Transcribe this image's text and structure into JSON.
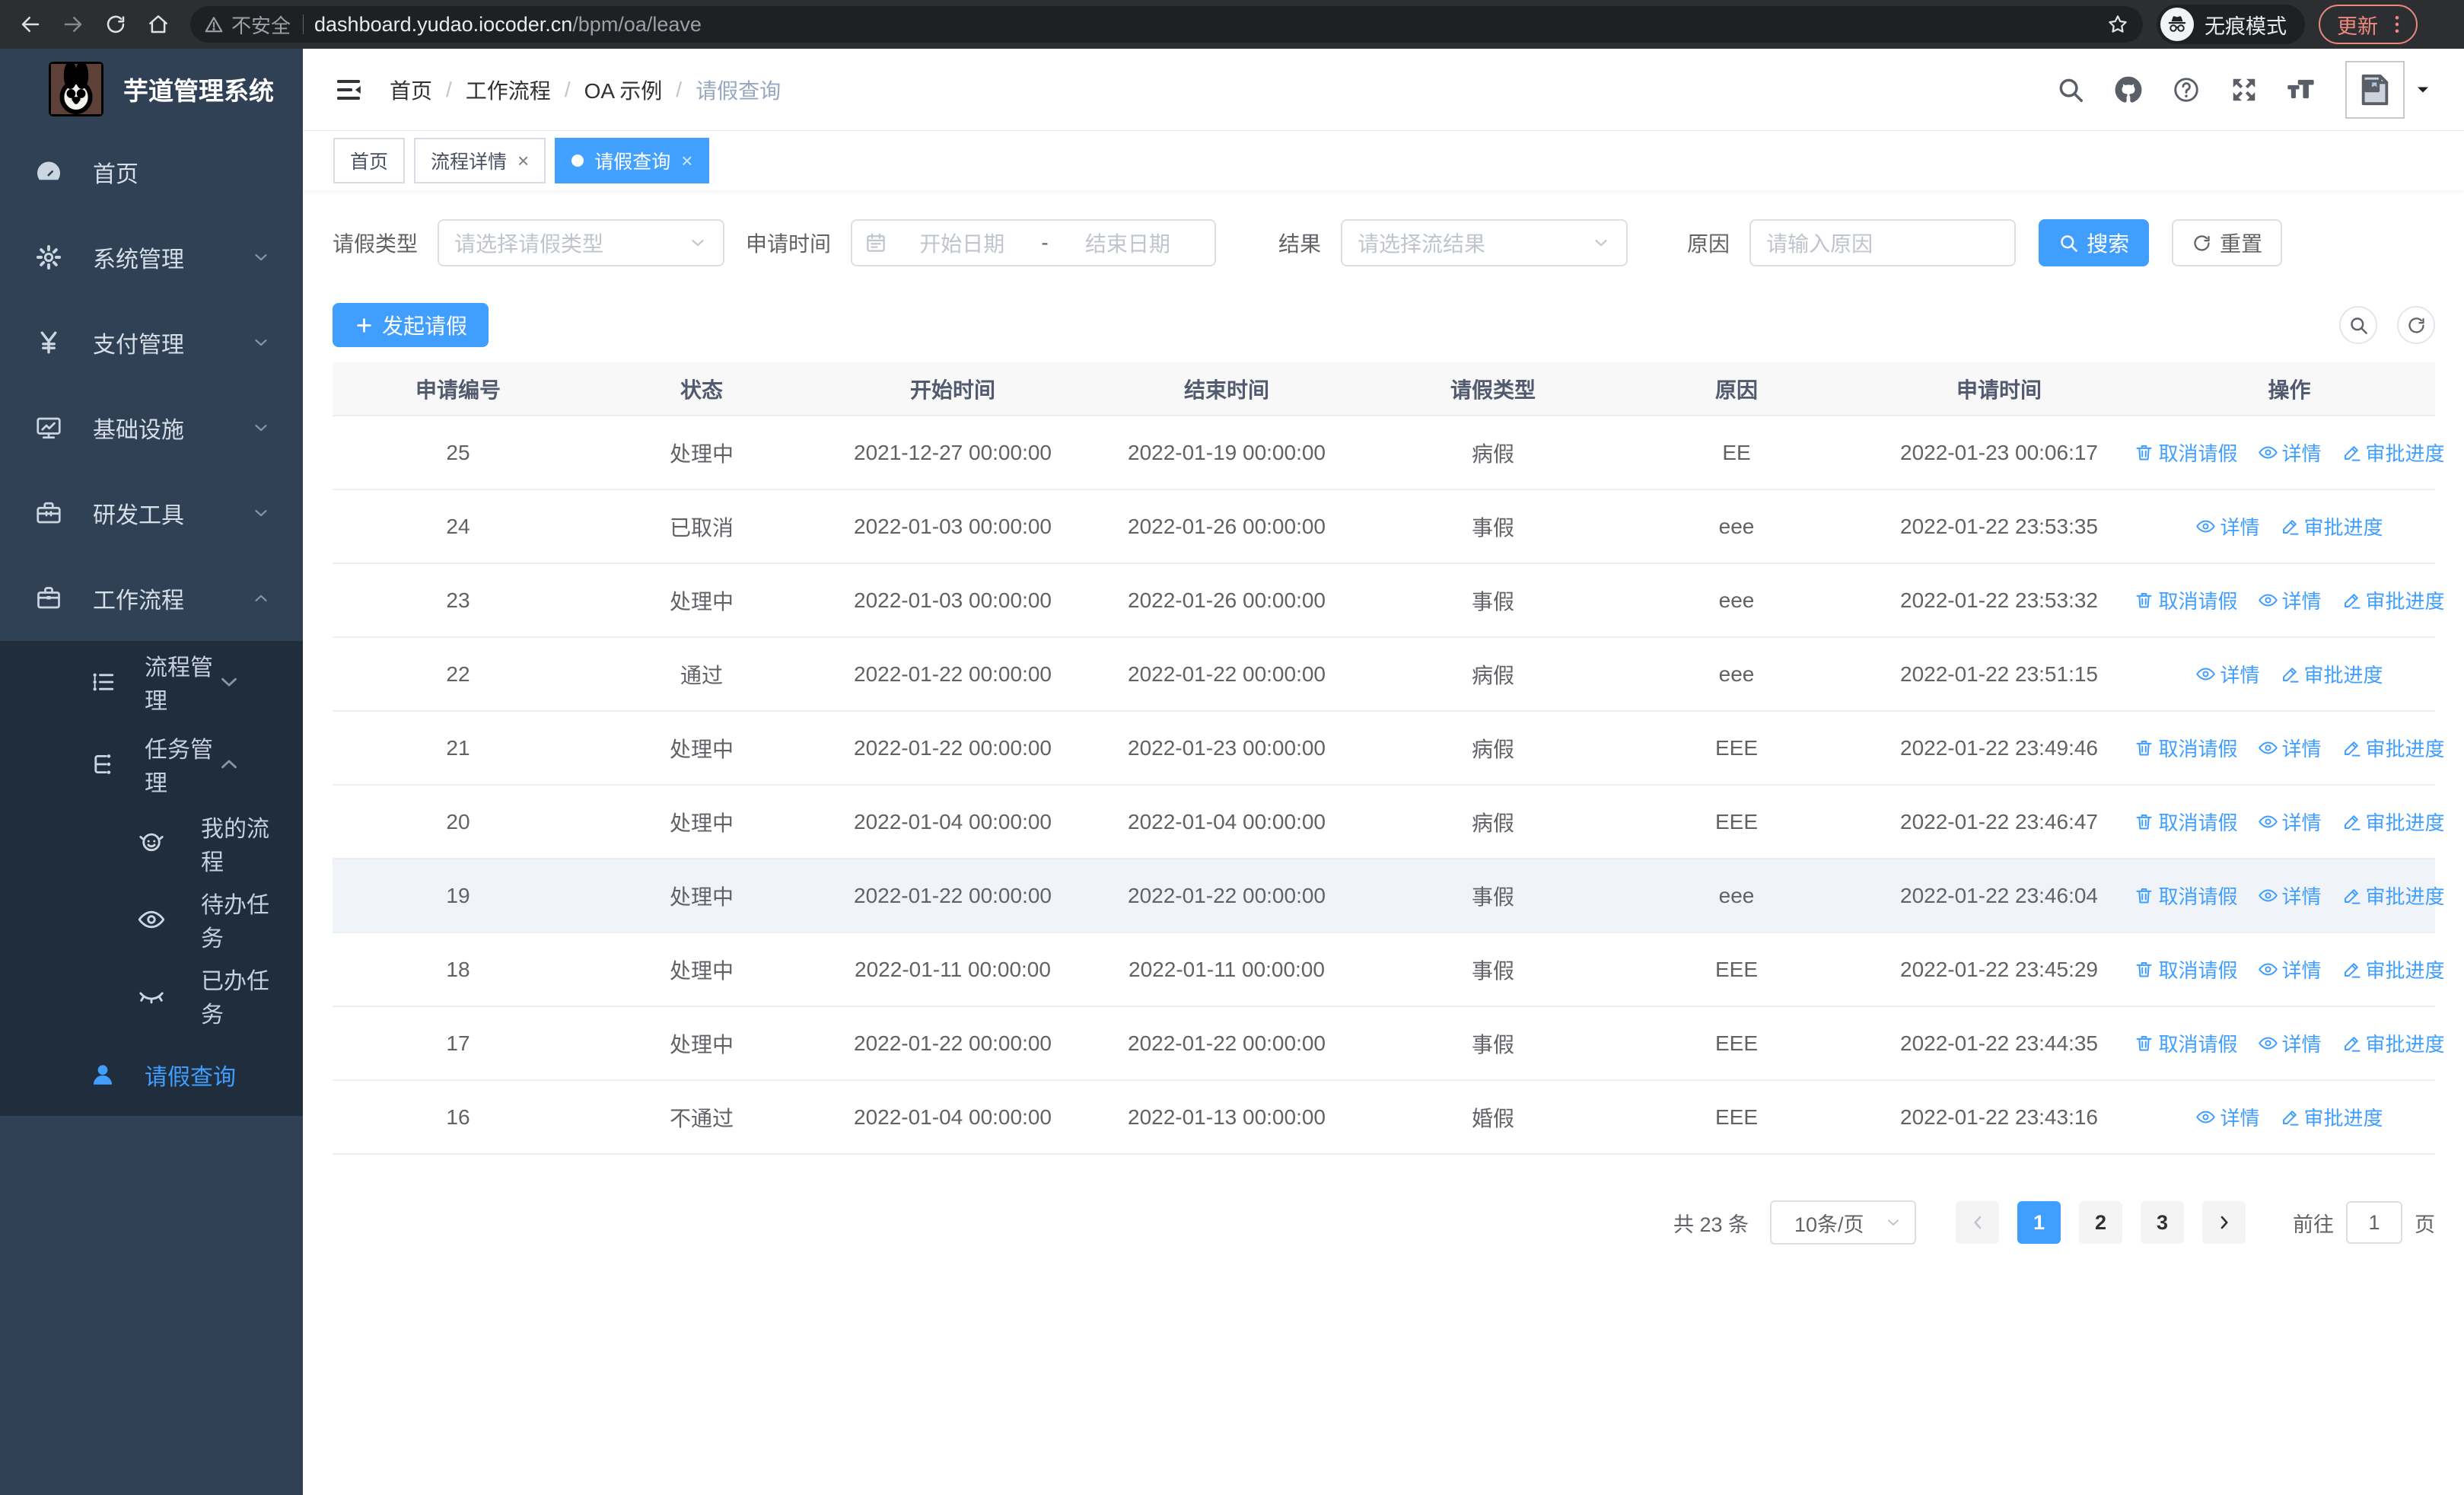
{
  "browser": {
    "security_label": "不安全",
    "url_host": "dashboard.yudao.iocoder.cn",
    "url_path": "/bpm/oa/leave",
    "incognito_label": "无痕模式",
    "update_label": "更新"
  },
  "sidebar": {
    "title": "芋道管理系统",
    "menu": [
      {
        "key": "home",
        "icon": "dashboard-icon",
        "label": "首页",
        "chevron": null
      },
      {
        "key": "system",
        "icon": "gear-icon",
        "label": "系统管理",
        "chevron": "down"
      },
      {
        "key": "payment",
        "icon": "yen-icon",
        "label": "支付管理",
        "chevron": "down"
      },
      {
        "key": "infra",
        "icon": "monitor-icon",
        "label": "基础设施",
        "chevron": "down"
      },
      {
        "key": "devtools",
        "icon": "toolbox-icon",
        "label": "研发工具",
        "chevron": "down"
      },
      {
        "key": "workflow",
        "icon": "briefcase-icon",
        "label": "工作流程",
        "chevron": "up"
      }
    ],
    "submenu": [
      {
        "key": "process-mgmt",
        "icon": "process-icon",
        "label": "流程管理",
        "level": 1,
        "chevron": "down",
        "active": false
      },
      {
        "key": "task-mgmt",
        "icon": "task-icon",
        "label": "任务管理",
        "level": 1,
        "chevron": "up",
        "active": false
      },
      {
        "key": "my-process",
        "icon": "my-process-icon",
        "label": "我的流程",
        "level": 2,
        "chevron": null,
        "active": false
      },
      {
        "key": "todo-tasks",
        "icon": "eye-open-icon",
        "label": "待办任务",
        "level": 2,
        "chevron": null,
        "active": false
      },
      {
        "key": "done-tasks",
        "icon": "eye-closed-icon",
        "label": "已办任务",
        "level": 2,
        "chevron": null,
        "active": false
      },
      {
        "key": "leave-query",
        "icon": "user-icon",
        "label": "请假查询",
        "level": 1,
        "chevron": null,
        "active": true
      }
    ]
  },
  "header": {
    "breadcrumb": [
      "首页",
      "工作流程",
      "OA 示例",
      "请假查询"
    ],
    "separator": "/"
  },
  "tabs": [
    {
      "label": "首页",
      "closable": false,
      "active": false
    },
    {
      "label": "流程详情",
      "closable": true,
      "active": false
    },
    {
      "label": "请假查询",
      "closable": true,
      "active": true
    }
  ],
  "icons": {
    "close-icon": "×",
    "dropdown-chevron": "∨"
  },
  "filters": {
    "leave_type_label": "请假类型",
    "leave_type_placeholder": "请选择请假类型",
    "apply_time_label": "申请时间",
    "start_date_placeholder": "开始日期",
    "date_separator": "-",
    "end_date_placeholder": "结束日期",
    "result_label": "结果",
    "result_placeholder": "请选择流结果",
    "reason_label": "原因",
    "reason_placeholder": "请输入原因",
    "search_label": "搜索",
    "reset_label": "重置"
  },
  "toolbar": {
    "create_label": "发起请假"
  },
  "table": {
    "columns": [
      "申请编号",
      "状态",
      "开始时间",
      "结束时间",
      "请假类型",
      "原因",
      "申请时间",
      "操作"
    ],
    "action_labels": {
      "cancel": "取消请假",
      "detail": "详情",
      "progress": "审批进度"
    },
    "rows": [
      {
        "id": "25",
        "status": "处理中",
        "start_time": "2021-12-27 00:00:00",
        "end_time": "2022-01-19 00:00:00",
        "leave_type": "病假",
        "reason": "EE",
        "apply_time": "2022-01-23 00:06:17",
        "actions": [
          "cancel",
          "detail",
          "progress"
        ],
        "highlighted": false
      },
      {
        "id": "24",
        "status": "已取消",
        "start_time": "2022-01-03 00:00:00",
        "end_time": "2022-01-26 00:00:00",
        "leave_type": "事假",
        "reason": "eee",
        "apply_time": "2022-01-22 23:53:35",
        "actions": [
          "detail",
          "progress"
        ],
        "highlighted": false
      },
      {
        "id": "23",
        "status": "处理中",
        "start_time": "2022-01-03 00:00:00",
        "end_time": "2022-01-26 00:00:00",
        "leave_type": "事假",
        "reason": "eee",
        "apply_time": "2022-01-22 23:53:32",
        "actions": [
          "cancel",
          "detail",
          "progress"
        ],
        "highlighted": false
      },
      {
        "id": "22",
        "status": "通过",
        "start_time": "2022-01-22 00:00:00",
        "end_time": "2022-01-22 00:00:00",
        "leave_type": "病假",
        "reason": "eee",
        "apply_time": "2022-01-22 23:51:15",
        "actions": [
          "detail",
          "progress"
        ],
        "highlighted": false
      },
      {
        "id": "21",
        "status": "处理中",
        "start_time": "2022-01-22 00:00:00",
        "end_time": "2022-01-23 00:00:00",
        "leave_type": "病假",
        "reason": "EEE",
        "apply_time": "2022-01-22 23:49:46",
        "actions": [
          "cancel",
          "detail",
          "progress"
        ],
        "highlighted": false
      },
      {
        "id": "20",
        "status": "处理中",
        "start_time": "2022-01-04 00:00:00",
        "end_time": "2022-01-04 00:00:00",
        "leave_type": "病假",
        "reason": "EEE",
        "apply_time": "2022-01-22 23:46:47",
        "actions": [
          "cancel",
          "detail",
          "progress"
        ],
        "highlighted": false
      },
      {
        "id": "19",
        "status": "处理中",
        "start_time": "2022-01-22 00:00:00",
        "end_time": "2022-01-22 00:00:00",
        "leave_type": "事假",
        "reason": "eee",
        "apply_time": "2022-01-22 23:46:04",
        "actions": [
          "cancel",
          "detail",
          "progress"
        ],
        "highlighted": true
      },
      {
        "id": "18",
        "status": "处理中",
        "start_time": "2022-01-11 00:00:00",
        "end_time": "2022-01-11 00:00:00",
        "leave_type": "事假",
        "reason": "EEE",
        "apply_time": "2022-01-22 23:45:29",
        "actions": [
          "cancel",
          "detail",
          "progress"
        ],
        "highlighted": false
      },
      {
        "id": "17",
        "status": "处理中",
        "start_time": "2022-01-22 00:00:00",
        "end_time": "2022-01-22 00:00:00",
        "leave_type": "事假",
        "reason": "EEE",
        "apply_time": "2022-01-22 23:44:35",
        "actions": [
          "cancel",
          "detail",
          "progress"
        ],
        "highlighted": false
      },
      {
        "id": "16",
        "status": "不通过",
        "start_time": "2022-01-04 00:00:00",
        "end_time": "2022-01-13 00:00:00",
        "leave_type": "婚假",
        "reason": "EEE",
        "apply_time": "2022-01-22 23:43:16",
        "actions": [
          "detail",
          "progress"
        ],
        "highlighted": false
      }
    ]
  },
  "pagination": {
    "total_label": "共 23 条",
    "page_size_label": "10条/页",
    "pages": [
      "1",
      "2",
      "3"
    ],
    "active_page": "1",
    "goto_label": "前往",
    "goto_value": "1",
    "page_unit_label": "页"
  },
  "colors": {
    "primary": "#409eff",
    "sidebar_bg": "#304156",
    "sidebar_submenu_bg": "#1f2d3d",
    "active_tab_bg": "#42a0ff",
    "link": "#409eff",
    "update_button": "#f08a7e",
    "table_header_bg": "#f8f8f9",
    "highlighted_row_bg": "#f0f3f8"
  }
}
